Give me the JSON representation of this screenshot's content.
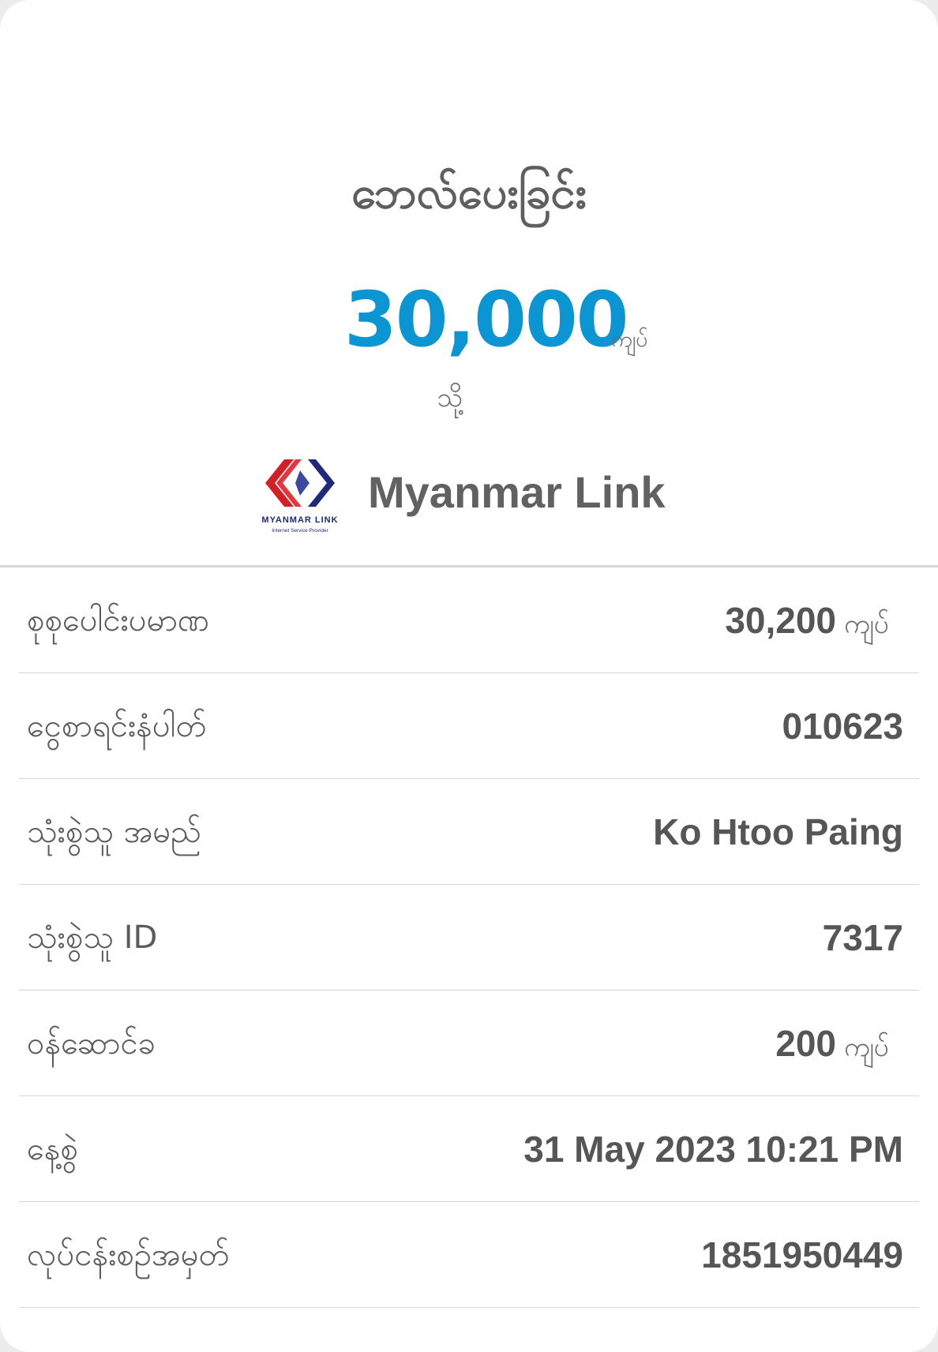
{
  "header": {
    "title": "ဘေလ်ပေးခြင်း",
    "amount": "30,000",
    "amount_unit": "ကျပ်",
    "to_label": "သို့",
    "merchant_name": "Myanmar Link",
    "logo": {
      "icon": "myanmar-link-logo",
      "brand_text": "MYANMAR LINK",
      "tagline": "Internet Service Provider",
      "colors": {
        "red": "#d32027",
        "navy": "#1f2a7a"
      }
    }
  },
  "details": [
    {
      "label": "စုစုပေါင်းပမာဏ",
      "value": "30,200",
      "unit": "ကျပ်"
    },
    {
      "label": "ငွေစာရင်းနံပါတ်",
      "value": "010623",
      "unit": ""
    },
    {
      "label": "သုံးစွဲသူ အမည်",
      "value": "Ko Htoo Paing",
      "unit": ""
    },
    {
      "label": "သုံးစွဲသူ ID",
      "value": "7317",
      "unit": ""
    },
    {
      "label": "ဝန်ဆောင်ခ",
      "value": "200",
      "unit": "ကျပ်"
    },
    {
      "label": "နေ့စွဲ",
      "value": "31 May 2023 10:21 PM",
      "unit": ""
    },
    {
      "label": "လုပ်ငန်းစဉ်အမှတ်",
      "value": "1851950449",
      "unit": ""
    }
  ],
  "colors": {
    "accent": "#0b95d2",
    "text": "#5f5f5f",
    "divider": "#d6d6d6"
  }
}
